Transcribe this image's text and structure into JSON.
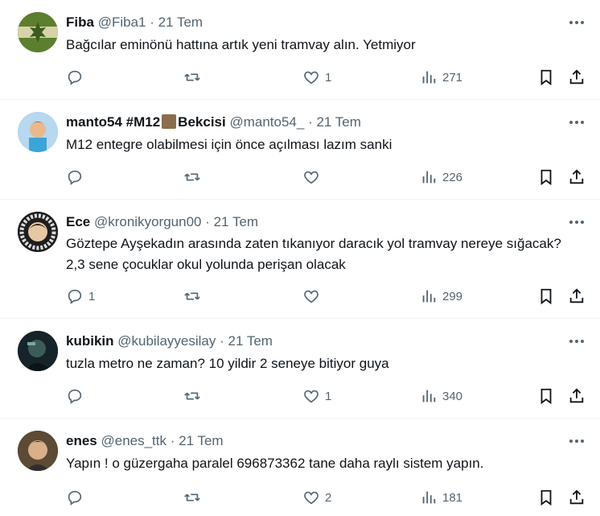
{
  "tweets": [
    {
      "name": "Fiba",
      "handle": "@Fiba1",
      "dot": "·",
      "time": "21 Tem",
      "text": "Bağcılar eminönü hattına artık yeni tramvay alın. Yetmiyor",
      "replies": "",
      "retweets": "",
      "likes": "1",
      "views": "271",
      "avatar": "green-flag-avatar"
    },
    {
      "name": "manto54 #M12",
      "name_suffix": "Bekcisi",
      "handle": "@manto54_",
      "dot": "·",
      "time": "21 Tem",
      "text": "M12 entegre olabilmesi için önce açılması lazım sanki",
      "replies": "",
      "retweets": "",
      "likes": "",
      "views": "226",
      "avatar": "child-photo-avatar"
    },
    {
      "name": "Ece",
      "handle": "@kronikyorgun00",
      "dot": "·",
      "time": "21 Tem",
      "text": "Göztepe Ayşekadın arasında zaten tıkanıyor daracık yol tramvay nereye sığacak? 2,3 sene çocuklar okul yolunda perişan olacak",
      "replies": "1",
      "retweets": "",
      "likes": "",
      "views": "299",
      "avatar": "badge-avatar"
    },
    {
      "name": "kubikin",
      "handle": "@kubilayyesilay",
      "dot": "·",
      "time": "21 Tem",
      "text": "tuzla metro ne zaman? 10 yildir 2 seneye bitiyor guya",
      "replies": "",
      "retweets": "",
      "likes": "1",
      "views": "340",
      "avatar": "dark-portrait-avatar"
    },
    {
      "name": "enes",
      "handle": "@enes_ttk",
      "dot": "·",
      "time": "21 Tem",
      "text": "Yapın ! o güzergaha paralel 696873362 tane daha raylı sistem yapın.",
      "replies": "",
      "retweets": "",
      "likes": "2",
      "views": "181",
      "avatar": "portrait-avatar"
    }
  ],
  "colors": {
    "text": "#0f1419",
    "muted": "#536471",
    "divider": "#eff3f4"
  }
}
